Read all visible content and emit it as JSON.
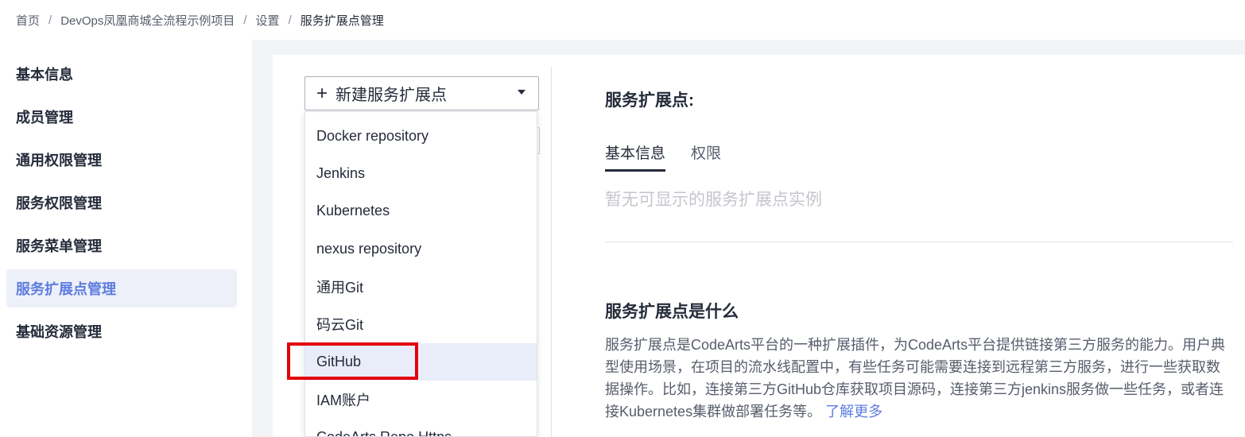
{
  "breadcrumb": {
    "items": [
      "首页",
      "DevOps凤凰商城全流程示例项目",
      "设置"
    ],
    "separator": "/",
    "current": "服务扩展点管理"
  },
  "sidebar": {
    "items": [
      {
        "label": "基本信息",
        "active": false
      },
      {
        "label": "成员管理",
        "active": false
      },
      {
        "label": "通用权限管理",
        "active": false
      },
      {
        "label": "服务权限管理",
        "active": false
      },
      {
        "label": "服务菜单管理",
        "active": false
      },
      {
        "label": "服务扩展点管理",
        "active": true
      },
      {
        "label": "基础资源管理",
        "active": false
      }
    ]
  },
  "new_button": {
    "icon": "plus-icon",
    "plus": "+",
    "label": "新建服务扩展点",
    "caret_icon": "caret-down-icon"
  },
  "dropdown": {
    "items": [
      "Docker repository",
      "Jenkins",
      "Kubernetes",
      "nexus repository",
      "通用Git",
      "码云Git",
      "GitHub",
      "IAM账户",
      "CodeArts Repo Https"
    ],
    "hovered": "GitHub"
  },
  "panel": {
    "title": "服务扩展点:",
    "tabs": [
      {
        "label": "基本信息",
        "active": true
      },
      {
        "label": "权限",
        "active": false
      }
    ],
    "empty_text": "暂无可显示的服务扩展点实例"
  },
  "what": {
    "title": "服务扩展点是什么",
    "description": "服务扩展点是CodeArts平台的一种扩展插件，为CodeArts平台提供链接第三方服务的能力。用户典型使用场景，在项目的流水线配置中，有些任务可能需要连接到远程第三方服务，进行一些获取数据操作。比如，连接第三方GitHub仓库获取项目源码，连接第三方jenkins服务做一些任务，或者连接Kubernetes集群做部署任务等。",
    "link": "了解更多"
  },
  "colors": {
    "accent": "#5e7ce0",
    "highlight": "#e3000e",
    "active_bg": "#eef0f9",
    "hover_bg": "#e9edfa"
  }
}
